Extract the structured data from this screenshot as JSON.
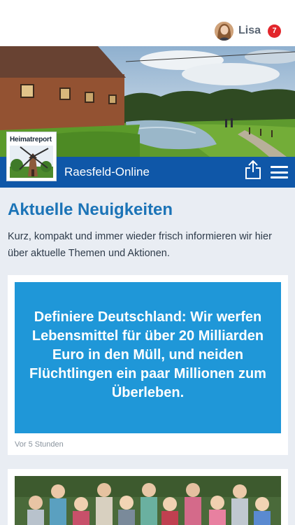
{
  "header": {
    "user_name": "Lisa",
    "notification_count": "7"
  },
  "brand": {
    "logo_text": "Heimatreport",
    "site_title": "Raesfeld-Online"
  },
  "main": {
    "heading": "Aktuelle Neuigkeiten",
    "intro": "Kurz, kompakt und immer wieder frisch informieren wir hier über aktuelle Themen und Aktionen.",
    "news": [
      {
        "image_text": "Definiere Deutschland: Wir werfen Lebensmittel für über 20 Milliarden Euro in den Müll, und neiden Flüchtlingen ein paar Millionen zum Überleben.",
        "time": "Vor 5 Stunden"
      },
      {
        "image_text": "",
        "time": ""
      }
    ]
  },
  "colors": {
    "primary_blue": "#0f57a8",
    "heading_blue": "#1c74b7",
    "badge_red": "#e2262b",
    "news_blue": "#1f97d8"
  },
  "icons": [
    "share-icon",
    "hamburger-menu-icon",
    "avatar"
  ]
}
